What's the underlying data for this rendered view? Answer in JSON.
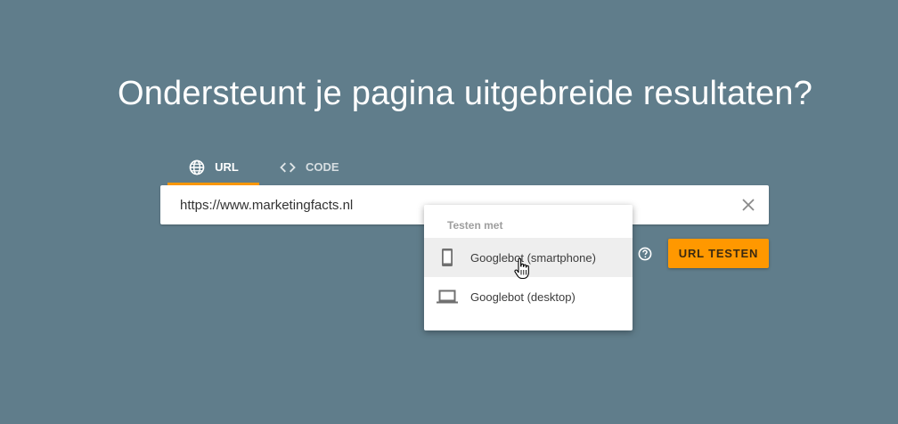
{
  "headline": "Ondersteunt je pagina uitgebreide resultaten?",
  "tabs": [
    {
      "label": "URL",
      "icon": "globe-icon",
      "active": true
    },
    {
      "label": "CODE",
      "icon": "code-icon",
      "active": false
    }
  ],
  "url_input": {
    "value": "https://www.marketingfacts.nl"
  },
  "menu": {
    "header": "Testen met",
    "items": [
      {
        "label": "Googlebot (smartphone)",
        "icon": "smartphone-icon",
        "hovered": true
      },
      {
        "label": "Googlebot (desktop)",
        "icon": "laptop-icon",
        "hovered": false
      }
    ]
  },
  "test_button": {
    "label": "URL TESTEN"
  },
  "colors": {
    "background": "#607d8b",
    "accent": "#ff9800",
    "hover": "#eeeeee"
  }
}
